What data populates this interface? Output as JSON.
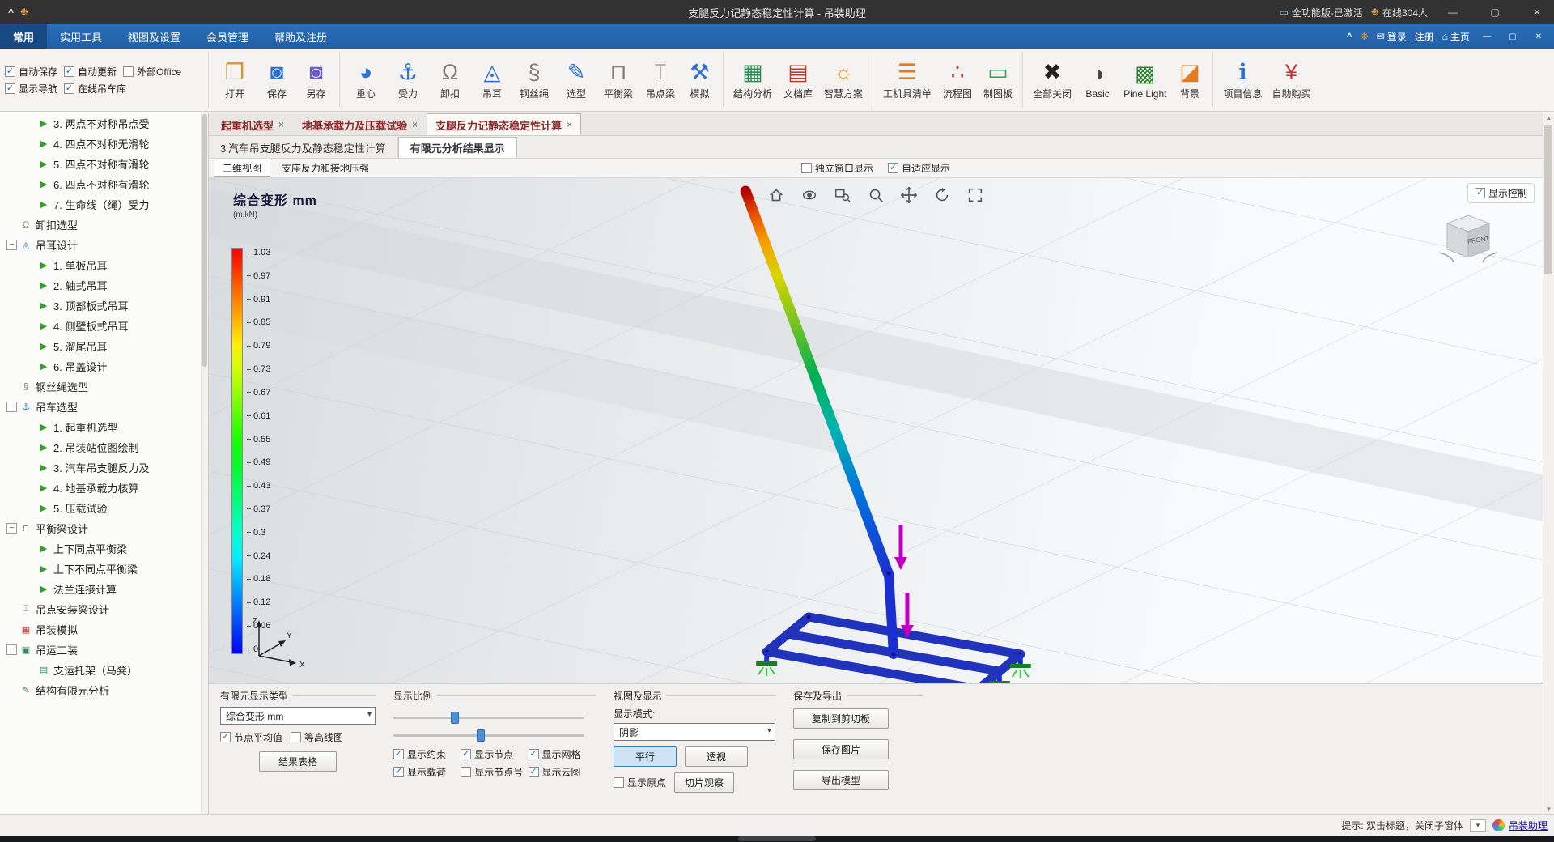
{
  "title_bar": {
    "title": "支腿反力记静态稳定性计算 - 吊装助理",
    "license_badge": "全功能版-已激活",
    "online_badge": "在线304人"
  },
  "menu_bar": {
    "items": [
      {
        "label": "常用",
        "active": true
      },
      {
        "label": "实用工具"
      },
      {
        "label": "视图及设置"
      },
      {
        "label": "会员管理"
      },
      {
        "label": "帮助及注册"
      }
    ],
    "right": {
      "login": "登录",
      "register": "注册",
      "home": "主页"
    }
  },
  "toolbar": {
    "checkboxes": [
      {
        "label": "自动保存",
        "checked": true
      },
      {
        "label": "自动更新",
        "checked": true
      },
      {
        "label": "外部Office",
        "checked": false
      },
      {
        "label": "显示导航",
        "checked": true
      },
      {
        "label": "在线吊车库",
        "checked": true
      }
    ],
    "buttons": [
      {
        "label": "打开",
        "icon": "open"
      },
      {
        "label": "保存",
        "icon": "save"
      },
      {
        "label": "另存",
        "icon": "save_as",
        "gend": true
      },
      {
        "label": "重心",
        "icon": "gravity"
      },
      {
        "label": "受力",
        "icon": "force"
      },
      {
        "label": "卸扣",
        "icon": "shackle"
      },
      {
        "label": "吊耳",
        "icon": "lug"
      },
      {
        "label": "钢丝绳",
        "icon": "rope"
      },
      {
        "label": "选型",
        "icon": "pencil"
      },
      {
        "label": "平衡梁",
        "icon": "beam"
      },
      {
        "label": "吊点梁",
        "icon": "ibeam"
      },
      {
        "label": "模拟",
        "icon": "sim",
        "gend": true
      },
      {
        "label": "结构分析",
        "icon": "analysis"
      },
      {
        "label": "文档库",
        "icon": "docs"
      },
      {
        "label": "智慧方案",
        "icon": "smart",
        "gend": true
      },
      {
        "label": "工机具清单",
        "icon": "list"
      },
      {
        "label": "流程图",
        "icon": "flow"
      },
      {
        "label": "制图板",
        "icon": "board",
        "gend": true
      },
      {
        "label": "全部关闭",
        "icon": "close_all"
      },
      {
        "label": "Basic",
        "icon": "theme_basic",
        "dropdown": true
      },
      {
        "label": "Pine Light",
        "icon": "theme_pine",
        "dropdown": true
      },
      {
        "label": "背景",
        "icon": "background",
        "gend": true
      },
      {
        "label": "项目信息",
        "icon": "info"
      },
      {
        "label": "自助购买",
        "icon": "buy"
      }
    ]
  },
  "sidebar": {
    "items": [
      {
        "label": "3. 两点不对称吊点受",
        "level": 2,
        "icon": "leaf"
      },
      {
        "label": "4. 四点不对称无滑轮",
        "level": 2,
        "icon": "leaf"
      },
      {
        "label": "5. 四点不对称有滑轮",
        "level": 2,
        "icon": "leaf"
      },
      {
        "label": "6. 四点不对称有滑轮",
        "level": 2,
        "icon": "leaf"
      },
      {
        "label": "7. 生命线（绳）受力",
        "level": 2,
        "icon": "leaf"
      },
      {
        "label": "卸扣选型",
        "level": 1,
        "icon": "shackle"
      },
      {
        "label": "吊耳设计",
        "level": 1,
        "icon": "lug",
        "parent": true
      },
      {
        "label": "1. 单板吊耳",
        "level": 2,
        "icon": "leaf"
      },
      {
        "label": "2. 轴式吊耳",
        "level": 2,
        "icon": "leaf"
      },
      {
        "label": "3. 顶部板式吊耳",
        "level": 2,
        "icon": "leaf"
      },
      {
        "label": "4. 侧壁板式吊耳",
        "level": 2,
        "icon": "leaf"
      },
      {
        "label": "5. 溜尾吊耳",
        "level": 2,
        "icon": "leaf"
      },
      {
        "label": "6. 吊盖设计",
        "level": 2,
        "icon": "leaf"
      },
      {
        "label": "钢丝绳选型",
        "level": 1,
        "icon": "rope"
      },
      {
        "label": "吊车选型",
        "level": 1,
        "icon": "force",
        "parent": true
      },
      {
        "label": "1. 起重机选型",
        "level": 2,
        "icon": "leaf"
      },
      {
        "label": "2. 吊装站位图绘制",
        "level": 2,
        "icon": "leaf"
      },
      {
        "label": "3. 汽车吊支腿反力及",
        "level": 2,
        "icon": "leaf"
      },
      {
        "label": "4. 地基承载力核算",
        "level": 2,
        "icon": "leaf"
      },
      {
        "label": "5. 压载试验",
        "level": 2,
        "icon": "leaf"
      },
      {
        "label": "平衡梁设计",
        "level": 1,
        "icon": "beam",
        "parent": true
      },
      {
        "label": "上下同点平衡梁",
        "level": 2,
        "icon": "leaf"
      },
      {
        "label": "上下不同点平衡梁",
        "level": 2,
        "icon": "leaf"
      },
      {
        "label": "法兰连接计算",
        "level": 2,
        "icon": "leaf"
      },
      {
        "label": "吊点安装梁设计",
        "level": 1,
        "icon": "ibeam"
      },
      {
        "label": "吊装模拟",
        "level": 1,
        "icon": "tree_sim"
      },
      {
        "label": "吊运工装",
        "level": 1,
        "icon": "tree_tooling",
        "parent": true
      },
      {
        "label": "支运托架（马凳）",
        "level": 2,
        "icon": "tree_bracket"
      },
      {
        "label": "结构有限元分析",
        "level": 1,
        "icon": "tree_fea"
      }
    ]
  },
  "tabs": [
    {
      "label": "起重机选型"
    },
    {
      "label": "地基承载力及压载试验"
    },
    {
      "label": "支腿反力记静态稳定性计算",
      "active": true
    }
  ],
  "subtabs": [
    {
      "label": "3'汽车吊支腿反力及静态稳定性计算"
    },
    {
      "label": "有限元分析结果显示",
      "active": true
    }
  ],
  "viewbar": {
    "tabs": [
      {
        "label": "三维视图",
        "active": true
      },
      {
        "label": "支座反力和接地压强"
      }
    ],
    "checkboxes": [
      {
        "label": "独立窗口显示",
        "checked": false
      },
      {
        "label": "自适应显示",
        "checked": true
      }
    ]
  },
  "viewport": {
    "legend_title": "综合变形  mm",
    "legend_units": "(m,kN)",
    "legend_values": [
      "1.03",
      "0.97",
      "0.91",
      "0.85",
      "0.79",
      "0.73",
      "0.67",
      "0.61",
      "0.55",
      "0.49",
      "0.43",
      "0.37",
      "0.3",
      "0.24",
      "0.18",
      "0.12",
      "0.06",
      "0"
    ],
    "legend_colors": [
      "#ff0000",
      "#ff3b00",
      "#ff7700",
      "#ffb200",
      "#ffee00",
      "#d4ff00",
      "#99ff00",
      "#55ff00",
      "#1bff00",
      "#00ff1e",
      "#00ff59",
      "#00ff95",
      "#00ffd0",
      "#00eeff",
      "#00b2ff",
      "#0077ff",
      "#003bff",
      "#0000ff"
    ],
    "display_control_label": "显示控制",
    "display_control_checked": true,
    "cube_label": "FRONT",
    "axes": {
      "x": "X",
      "y": "Y",
      "z": "Z"
    }
  },
  "bottom_panel": {
    "fe_group": {
      "title": "有限元显示类型",
      "dropdown_value": "综合变形 mm",
      "checkboxes": [
        {
          "label": "节点平均值",
          "checked": true
        },
        {
          "label": "等高线图",
          "checked": false
        }
      ],
      "table_button": "结果表格"
    },
    "scale_group": {
      "title": "显示比例",
      "sliders": [
        {
          "pct": 30
        },
        {
          "pct": 44
        }
      ],
      "checkboxes": [
        {
          "label": "显示约束",
          "checked": true
        },
        {
          "label": "显示节点",
          "checked": true
        },
        {
          "label": "显示网格",
          "checked": true
        },
        {
          "label": "显示载荷",
          "checked": true
        },
        {
          "label": "显示节点号",
          "checked": false
        },
        {
          "label": "显示云图",
          "checked": true
        }
      ]
    },
    "view_group": {
      "title": "视图及显示",
      "mode_label": "显示模式:",
      "mode_value": "阴影",
      "parallel_button": "平行",
      "perspective_button": "透视",
      "origin_checkbox": {
        "label": "显示原点",
        "checked": false
      },
      "slice_button": "切片观察"
    },
    "save_group": {
      "title": "保存及导出",
      "buttons": [
        {
          "label": "复制到剪切板"
        },
        {
          "label": "保存图片"
        },
        {
          "label": "导出模型"
        }
      ]
    }
  },
  "status_bar": {
    "hint": "提示: 双击标题，关闭子窗体",
    "brand": "吊装助理"
  },
  "icon_map": {
    "open": {
      "glyph": "❐",
      "color": "#d9952b"
    },
    "save": {
      "glyph": "◙",
      "color": "#2a6fd6"
    },
    "save_as": {
      "glyph": "◙",
      "color": "#6a5acd"
    },
    "gravity": {
      "glyph": "◕",
      "color": "#2a6fd6"
    },
    "force": {
      "glyph": "⚓",
      "color": "#2a6fd6"
    },
    "shackle": {
      "glyph": "Ω",
      "color": "#7d7d7d"
    },
    "lug": {
      "glyph": "◬",
      "color": "#2a6fd6"
    },
    "rope": {
      "glyph": "§",
      "color": "#7d7d7d"
    },
    "pencil": {
      "glyph": "✎",
      "color": "#2a6fd6"
    },
    "beam": {
      "glyph": "⊓",
      "color": "#7d7d7d"
    },
    "ibeam": {
      "glyph": "⌶",
      "color": "#7d7d7d"
    },
    "sim": {
      "glyph": "⚒",
      "color": "#2a6fd6"
    },
    "analysis": {
      "glyph": "▦",
      "color": "#2e8b57"
    },
    "docs": {
      "glyph": "▤",
      "color": "#c0392b"
    },
    "smart": {
      "glyph": "☼",
      "color": "#e8a020"
    },
    "list": {
      "glyph": "☰",
      "color": "#e07b20"
    },
    "flow": {
      "glyph": "∴",
      "color": "#d04040"
    },
    "board": {
      "glyph": "▭",
      "color": "#2e9e50"
    },
    "close_all": {
      "glyph": "✖",
      "color": "#222222"
    },
    "theme_basic": {
      "glyph": "◑",
      "color": "#444444"
    },
    "theme_pine": {
      "glyph": "▩",
      "color": "#2e7d32"
    },
    "background": {
      "glyph": "◪",
      "color": "#e07b20"
    },
    "info": {
      "glyph": "ℹ",
      "color": "#2a6fd6"
    },
    "buy": {
      "glyph": "¥",
      "color": "#d03030"
    },
    "leaf": {
      "glyph": "▶",
      "color": "#33a02c"
    },
    "tree_sim": {
      "glyph": "▦",
      "color": "#c0392b"
    },
    "tree_tooling": {
      "glyph": "▣",
      "color": "#2e8b57"
    },
    "tree_bracket": {
      "glyph": "▤",
      "color": "#2e8b57"
    },
    "tree_fea": {
      "glyph": "✎",
      "color": "#3a7a3a"
    }
  }
}
